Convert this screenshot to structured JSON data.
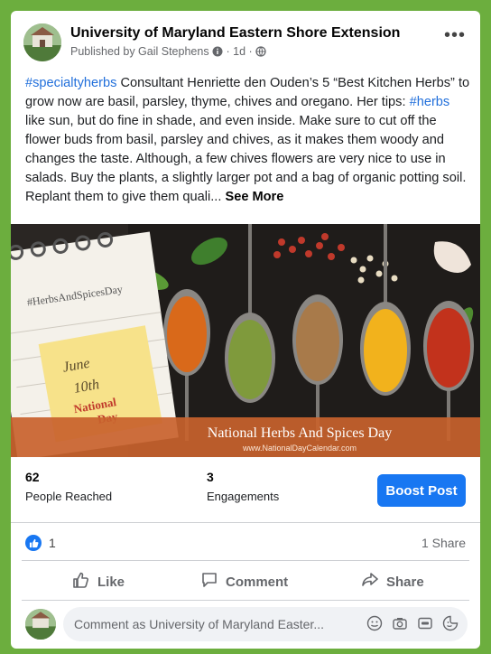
{
  "page": {
    "name": "University of Maryland Eastern Shore Extension"
  },
  "byline": {
    "published_by": "Published by Gail Stephens",
    "time": "· 1d ·"
  },
  "post": {
    "hashtag1": "#specialtyherbs",
    "text1": " Consultant Henriette den Ouden’s 5 “Best Kitchen Herbs” to grow now are basil, parsley, thyme, chives and oregano.  Her tips: ",
    "hashtag2": "#herbs",
    "text2": " like sun, but do fine in shade, and even inside. Make sure to cut off the flower buds from basil, parsley and chives, as it makes them woody and changes the taste. Although, a few chives flowers are very nice to use in salads. Buy the plants, a slightly larger pot and a bag of organic potting soil. Replant them to give them quali... ",
    "see_more": "See More"
  },
  "image": {
    "notepad_tag": "#HerbsAndSpicesDay",
    "note_month": "June",
    "note_day": "10th",
    "note_national": "National",
    "note_day_word": "Day",
    "banner_title": "National Herbs And Spices Day",
    "banner_url": "www.NationalDayCalendar.com",
    "spice_colors": [
      "#d9691a",
      "#7f9a3c",
      "#a87a4a",
      "#f2b21c",
      "#c2321c"
    ]
  },
  "stats": {
    "reached_count": "62",
    "reached_label": "People Reached",
    "engagements_count": "3",
    "engagements_label": "Engagements",
    "boost_label": "Boost Post"
  },
  "reactions": {
    "like_count": "1",
    "shares": "1 Share"
  },
  "actions": {
    "like": "Like",
    "comment": "Comment",
    "share": "Share"
  },
  "comment": {
    "placeholder": "Comment as University of Maryland Easter..."
  },
  "colors": {
    "accent": "#1877f2",
    "frame": "#6cae3e",
    "hashtag": "#216fdb"
  }
}
